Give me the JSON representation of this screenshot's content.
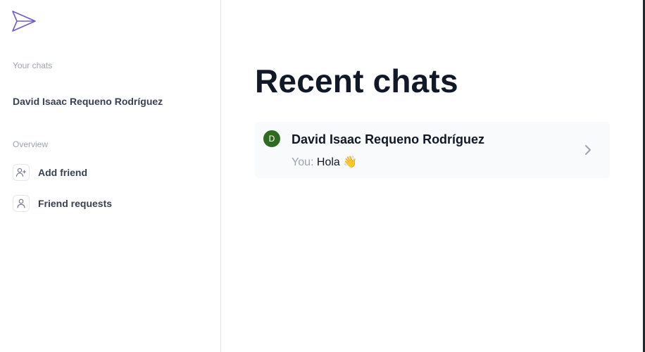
{
  "sidebar": {
    "your_chats_label": "Your chats",
    "chats": [
      {
        "name": "David Isaac Requeno Rodríguez"
      }
    ],
    "overview_label": "Overview",
    "overview_items": [
      {
        "label": "Add friend",
        "icon": "user-plus-icon"
      },
      {
        "label": "Friend requests",
        "icon": "user-icon"
      }
    ]
  },
  "main": {
    "title": "Recent chats",
    "recent_chats": [
      {
        "avatar_initial": "D",
        "name": "David Isaac Requeno Rodríguez",
        "preview_prefix": "You: ",
        "preview_text": "Hola 👋"
      }
    ]
  },
  "colors": {
    "brand": "#6d5bd0",
    "avatar_bg": "#2f6b1f",
    "card_bg": "#f9fafb"
  }
}
